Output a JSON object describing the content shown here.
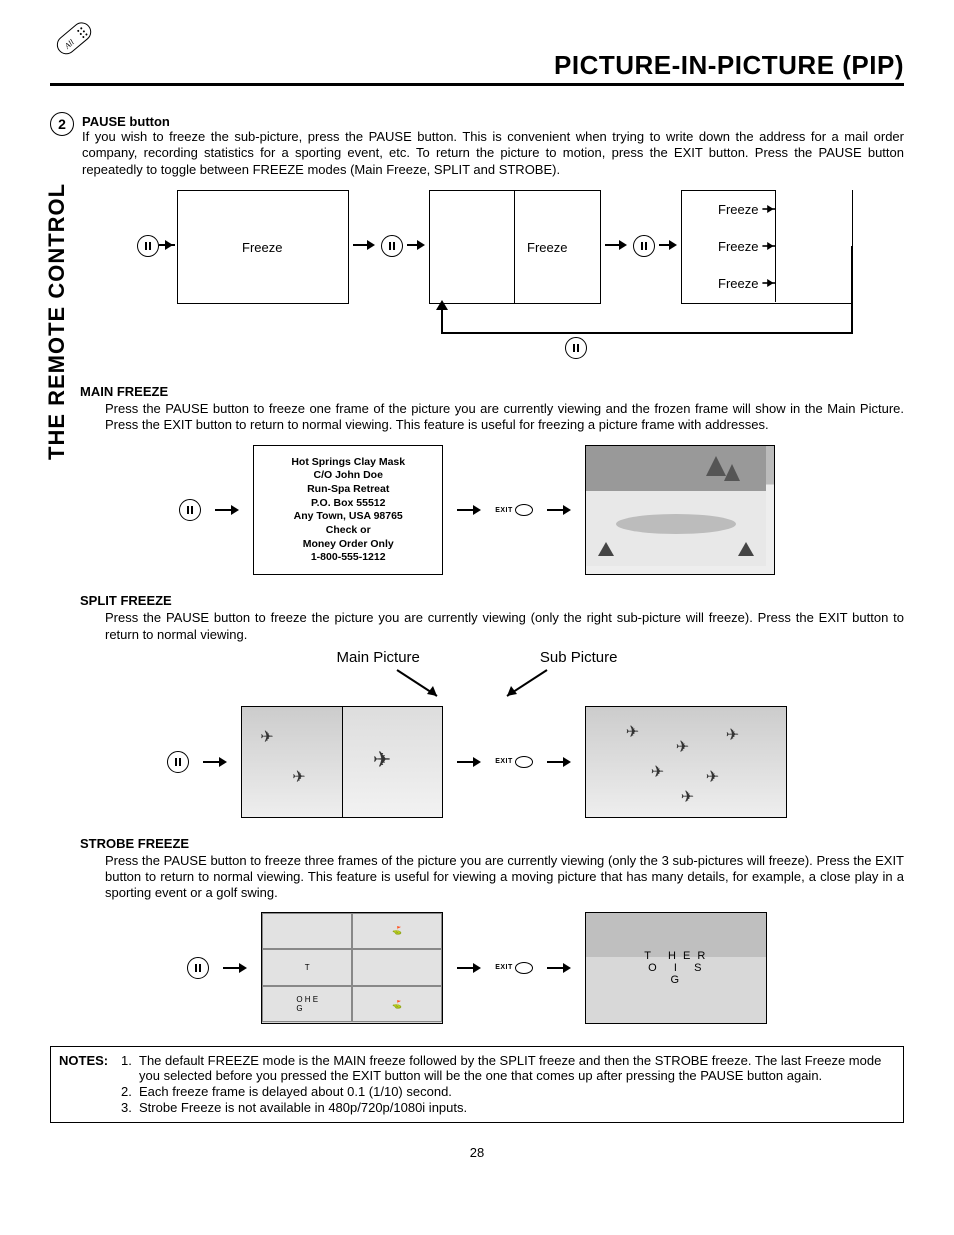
{
  "header": {
    "section_title": "PICTURE-IN-PICTURE (PIP)",
    "side_tab": "THE REMOTE CONTROL"
  },
  "step": {
    "number": "2",
    "heading": "PAUSE button",
    "body": "If you wish to freeze the sub-picture, press the PAUSE button. This is convenient when trying to write down the address for a mail order company, recording statistics for a sporting event, etc.  To return the picture to motion, press the EXIT button.  Press the PAUSE button repeatedly to toggle between FREEZE modes (Main Freeze, SPLIT and STROBE)."
  },
  "cycle": {
    "freeze_label": "Freeze"
  },
  "main_freeze": {
    "heading": "MAIN FREEZE",
    "body": "Press the PAUSE button to freeze one frame of the picture you are currently viewing and the frozen frame will show in the Main Picture.  Press the EXIT button to return to normal viewing.  This feature is useful for freezing a picture frame with addresses.",
    "ad_lines": [
      "Hot Springs Clay Mask",
      "C/O John Doe",
      "Run-Spa Retreat",
      "P.O. Box 55512",
      "Any Town, USA 98765",
      "Check or",
      "Money Order Only",
      "1-800-555-1212"
    ],
    "exit_label": "EXIT"
  },
  "split_freeze": {
    "heading": "SPLIT FREEZE",
    "body": "Press the PAUSE button to freeze the picture you are currently viewing (only the right sub-picture will freeze).  Press the EXIT button to return to normal viewing.",
    "main_label": "Main Picture",
    "sub_label": "Sub Picture",
    "exit_label": "EXIT"
  },
  "strobe_freeze": {
    "heading": "STROBE FREEZE",
    "body": "Press the PAUSE button to freeze three frames of the picture you are currently viewing (only the 3 sub-pictures will freeze). Press the EXIT button to return to normal viewing. This feature is useful for viewing a moving picture that has many details, for example, a close play in a sporting event or a golf swing.",
    "exit_label": "EXIT"
  },
  "notes": {
    "label": "NOTES:",
    "items": [
      {
        "n": "1.",
        "t": "The default FREEZE mode is the MAIN freeze followed by the SPLIT freeze and then the STROBE freeze.  The last Freeze mode you selected before you pressed the EXIT button will be the one that comes up after pressing the PAUSE button again."
      },
      {
        "n": "2.",
        "t": "Each freeze frame is delayed about 0.1 (1/10) second."
      },
      {
        "n": "3.",
        "t": "Strobe Freeze is not available in 480p/720p/1080i inputs."
      }
    ]
  },
  "page_number": "28"
}
